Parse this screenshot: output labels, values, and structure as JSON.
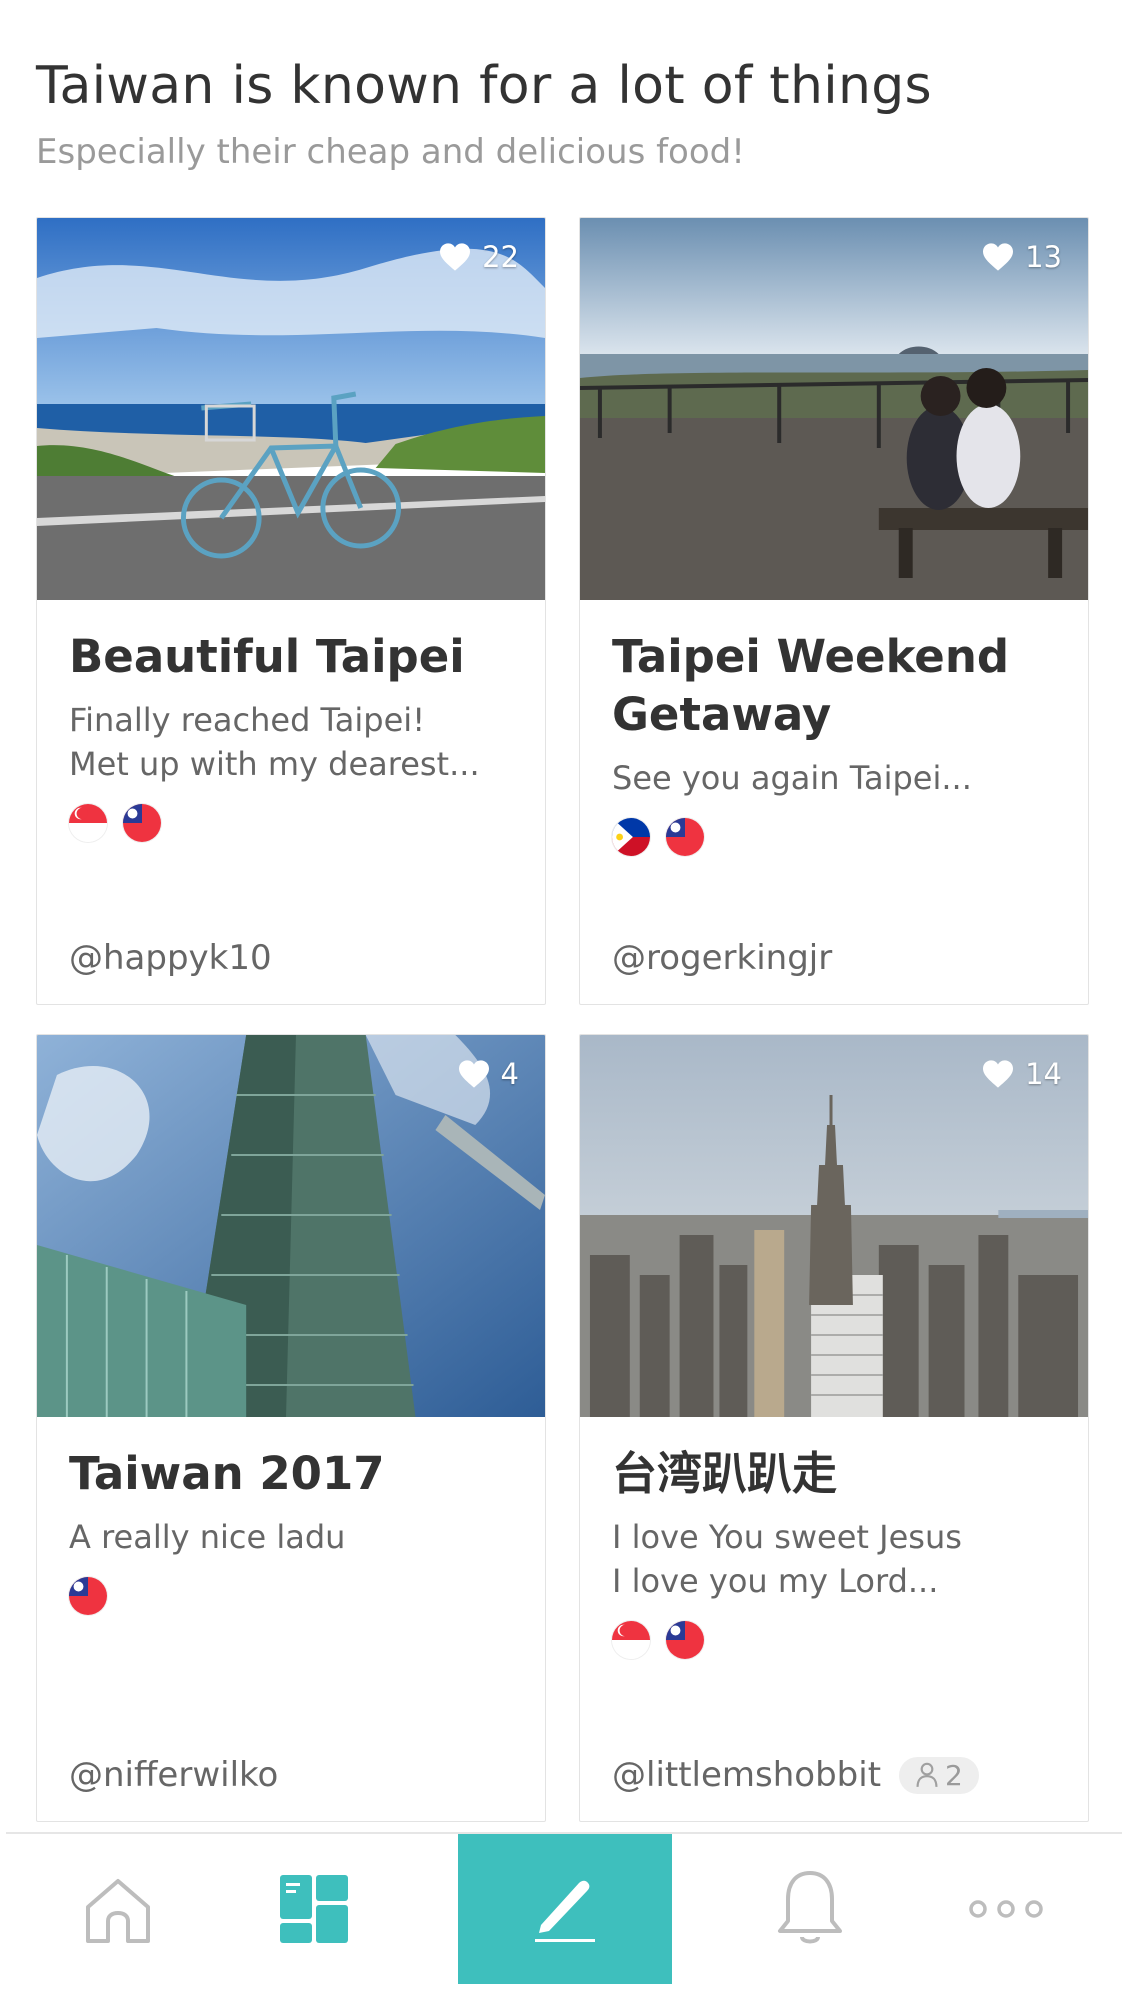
{
  "header": {
    "title": "Taiwan is known for a lot of things",
    "subtitle": "Especially their cheap and delicious food!"
  },
  "cards": [
    {
      "likes": "22",
      "title": "Beautiful Taipei",
      "excerpt": "Finally reached Taipei!\nMet up with my dearest...",
      "flags": [
        "singapore",
        "taiwan"
      ],
      "author": "@happyk10",
      "photo": "bicycle-beach"
    },
    {
      "likes": "13",
      "title": "Taipei Weekend Getaway",
      "excerpt": "See you again Taipei...",
      "flags": [
        "philippines",
        "taiwan"
      ],
      "author": "@rogerkingjr",
      "photo": "couple-boardwalk"
    },
    {
      "likes": "4",
      "title": "Taiwan 2017",
      "excerpt": "A really nice ladu",
      "flags": [
        "taiwan"
      ],
      "author": "@nifferwilko",
      "photo": "taipei-101"
    },
    {
      "likes": "14",
      "title": "台湾趴趴走",
      "excerpt": "I love You sweet Jesus\nI love you my Lord...",
      "flags": [
        "singapore",
        "taiwan"
      ],
      "author": "@littlemshobbit",
      "collaborators": "2",
      "photo": "city-skyline"
    }
  ],
  "nav": {
    "items": [
      "home",
      "feed",
      "compose",
      "notifications",
      "more"
    ],
    "active": "feed",
    "accent": "#3ebfbd",
    "icon_color": "#bdbdbd"
  }
}
